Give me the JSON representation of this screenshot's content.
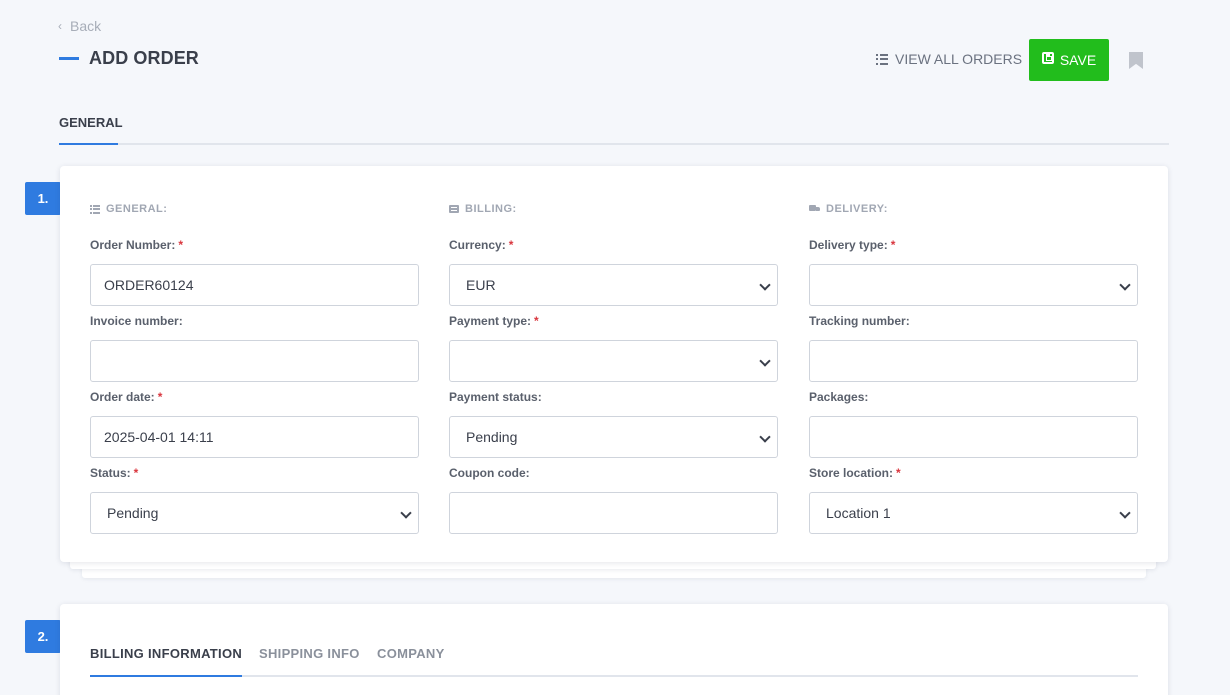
{
  "nav": {
    "back_label": "Back"
  },
  "header": {
    "title": "ADD ORDER",
    "view_all_label": "VIEW ALL ORDERS",
    "save_label": "SAVE"
  },
  "main_tabs": [
    {
      "label": "GENERAL"
    }
  ],
  "steps": [
    {
      "number": "1."
    },
    {
      "number": "2."
    }
  ],
  "general_card": {
    "general": {
      "heading": "GENERAL:",
      "order_number_label": "Order Number:",
      "order_number_value": "ORDER60124",
      "invoice_number_label": "Invoice number:",
      "invoice_number_value": "",
      "order_date_label": "Order date:",
      "order_date_value": "2025-04-01 14:11",
      "status_label": "Status:",
      "status_value": "Pending"
    },
    "billing": {
      "heading": "BILLING:",
      "currency_label": "Currency:",
      "currency_value": "EUR",
      "payment_type_label": "Payment type:",
      "payment_type_value": "",
      "payment_status_label": "Payment status:",
      "payment_status_value": "Pending",
      "coupon_code_label": "Coupon code:",
      "coupon_code_value": ""
    },
    "delivery": {
      "heading": "DELIVERY:",
      "delivery_type_label": "Delivery type:",
      "delivery_type_value": "",
      "tracking_number_label": "Tracking number:",
      "tracking_number_value": "",
      "packages_label": "Packages:",
      "packages_value": "",
      "store_location_label": "Store location:",
      "store_location_value": "Location 1"
    },
    "required_mark": "*"
  },
  "info_card": {
    "tabs": [
      {
        "label": "BILLING INFORMATION"
      },
      {
        "label": "SHIPPING INFO"
      },
      {
        "label": "COMPANY"
      }
    ]
  },
  "colors": {
    "accent": "#2f7be0",
    "save_green": "#22bd1c",
    "required": "#d9363e"
  }
}
